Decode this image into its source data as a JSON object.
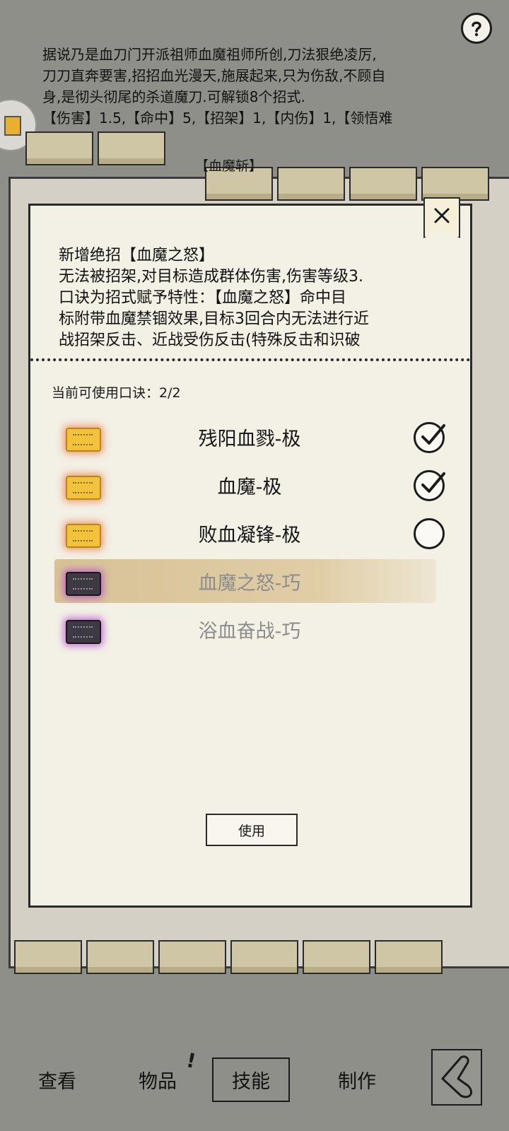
{
  "help": {
    "icon": "question-mark-icon"
  },
  "skill": {
    "description_lines": [
      "据说乃是血刀门开派祖师血魔祖师所创,刀法狠绝凌厉,",
      "刀刀直奔要害,招招血光漫天,施展起来,只为伤敌,不顾自",
      "身,是彻头彻尾的杀道魔刀.可解锁8个招式.",
      "【伤害】1.5,【命中】5,【招架】1,【内伤】1,【领悟难"
    ],
    "move_tag": "【血魔斩】"
  },
  "modal": {
    "desc_lines": [
      "新增绝招【血魔之怒】",
      "无法被招架,对目标造成群体伤害,伤害等级3.",
      "口诀为招式赋予特性：【血魔之怒】命中目",
      "标附带血魔禁锢效果,目标3回合内无法进行近",
      "战招架反击、近战受伤反击(特殊反击和识破"
    ],
    "count_label": "当前可使用口诀：2/2",
    "items": [
      {
        "name": "残阳血戮-极",
        "token": "gold",
        "checked": true
      },
      {
        "name": "血魔-极",
        "token": "gold",
        "checked": true
      },
      {
        "name": "败血凝锋-极",
        "token": "gold",
        "checked": false
      },
      {
        "name": "血魔之怒-巧",
        "token": "dark",
        "checked": null,
        "selected": true
      },
      {
        "name": "浴血奋战-巧",
        "token": "dark",
        "checked": null
      }
    ],
    "use_label": "使用",
    "close_icon": "close-x-icon"
  },
  "nav": {
    "view": "查看",
    "items": "物品",
    "items_badge": "!",
    "skills": "技能",
    "craft": "制作",
    "back_icon": "back-arrow-icon"
  },
  "colors": {
    "background": "#8f8f89",
    "modal": "#f3f0e6",
    "gold_glow": "#eb783c",
    "purple_glow": "#b446d2",
    "locked_text": "#8c8c8c"
  }
}
